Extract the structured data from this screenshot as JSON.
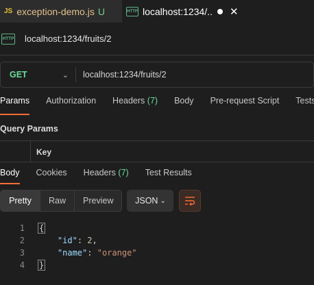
{
  "tabs": [
    {
      "icon": "JS",
      "title": "exception-demo.js",
      "status": "U"
    },
    {
      "icon": "HTTP",
      "title": "localhost:1234/...",
      "close": "✕"
    }
  ],
  "request": {
    "icon": "HTTP",
    "title": "localhost:1234/fruits/2",
    "method": "GET",
    "method_chevron": "⌄",
    "url": "localhost:1234/fruits/2"
  },
  "request_tabs": {
    "params": "Params",
    "authorization": "Authorization",
    "headers": "Headers",
    "headers_count": "(7)",
    "body": "Body",
    "pre_request_script": "Pre-request Script",
    "tests": "Tests"
  },
  "query_params": {
    "title": "Query Params",
    "key_header": "Key"
  },
  "response_tabs": {
    "body": "Body",
    "cookies": "Cookies",
    "headers": "Headers",
    "headers_count": "(7)",
    "test_results": "Test Results"
  },
  "toolbar": {
    "pretty": "Pretty",
    "raw": "Raw",
    "preview": "Preview",
    "format": "JSON",
    "format_chevron": "⌄"
  },
  "code": {
    "line_numbers": [
      "1",
      "2",
      "3",
      "4"
    ],
    "open_brace": "{",
    "close_brace": "}",
    "id_key": "\"id\"",
    "id_value": "2",
    "name_key": "\"name\"",
    "name_value": "\"orange\""
  },
  "colors": {
    "accent": "#ff6c37",
    "method": "#6bdd9a",
    "untracked": "#73c991",
    "js": "#e8c33c"
  }
}
